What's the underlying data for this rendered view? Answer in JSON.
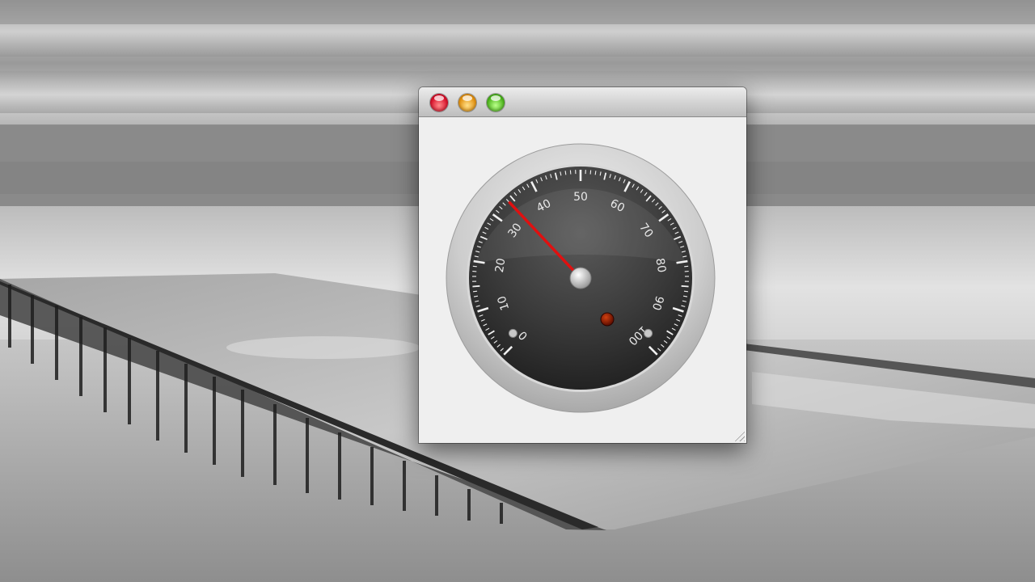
{
  "window": {
    "controls": [
      "close",
      "minimize",
      "zoom"
    ],
    "colors": {
      "close": "#e0203a",
      "minimize": "#f0a020",
      "zoom": "#5cc22a"
    }
  },
  "gauge": {
    "min": 0,
    "max": 100,
    "value": 34,
    "major_step": 10,
    "labels": [
      "0",
      "10",
      "20",
      "30",
      "40",
      "50",
      "60",
      "70",
      "80",
      "90",
      "100"
    ],
    "needle_color": "#e01010",
    "indicator_color": "#8a1a00",
    "face_color": "#3a3a3a",
    "bezel_color": "#c8c8c8"
  }
}
